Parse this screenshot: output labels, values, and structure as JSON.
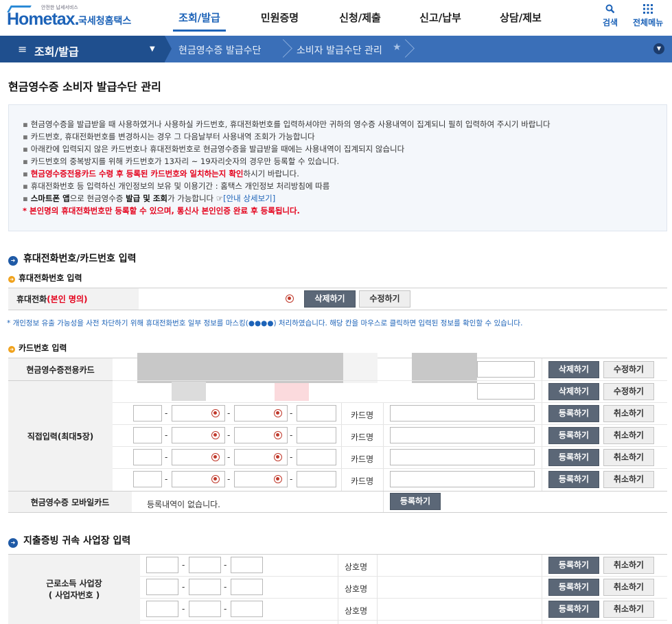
{
  "header": {
    "logo_small": "안전한 납세서비스",
    "logo_main": "Hometax.",
    "logo_kr": "국세청홈택스",
    "nav": [
      "조회/발급",
      "민원증명",
      "신청/제출",
      "신고/납부",
      "상담/제보"
    ],
    "search_label": "검색",
    "menu_label": "전체메뉴"
  },
  "locbar": {
    "current": "조회/발급",
    "crumb1": "현금영수증 발급수단",
    "crumb2": "소비자 발급수단 관리"
  },
  "page": {
    "title": "현금영수증 소비자 발급수단 관리"
  },
  "notice": [
    "현금영수증을 발급받을 때 사용하였거나 사용하실 카드번호, 휴대전화번호를 입력하셔야만 귀하의 영수증 사용내역이 집계되니 필히 입력하여 주시기 바랍니다",
    "카드번호, 휴대전화번호를 변경하시는 경우 그 다음날부터 사용내역 조회가 가능합니다",
    "아래칸에 입력되지 않은 카드번호나 휴대전화번호로 현금영수증을 발급받을 때에는 사용내역이 집계되지 않습니다",
    "카드번호의 중복방지를 위해 카드번호가 13자리 ~ 19자리숫자의 경우만 등록할 수 있습니다."
  ],
  "notice_red1": "현금영수증전용카드 수령 후 등록된 카드번호와 일치하는지 확인",
  "notice_red1_tail": "하시기 바랍니다.",
  "notice_privacy": "휴대전화번호 등 입력하신 개인정보의 보유 및 이용기간 : 홈택스 개인정보 처리방침에 따름",
  "notice_app_a": "스마트폰 앱",
  "notice_app_b": "으로 현금영수증 ",
  "notice_app_c": "발급 및 조회",
  "notice_app_d": "가 가능합니다 ",
  "notice_app_link": "[안내 상세보기]",
  "notice_red2": "* 본인명의 휴대전화번호만 등록할 수 있으며, 통신사 본인인증 완료 후 등록됩니다.",
  "section1": {
    "title": "휴대전화번호/카드번호 입력",
    "phone_sub": "휴대전화번호 입력",
    "phone_label": "휴대전화",
    "phone_label_red": "(본인 명의)",
    "delete": "삭제하기",
    "edit": "수정하기",
    "mask_note": "* 개인정보 유출 가능성을 사전 차단하기 위해 휴대전화번호 일부 정보를 마스킹(●●●●) 처리하였습니다. 해당 칸을 마우스로 클릭하면 입력된 정보를 확인할 수 있습니다.",
    "card_sub": "카드번호 입력",
    "card_dedicated": "현금영수증전용카드",
    "card_direct": "직접입력(최대5장)",
    "card_name": "카드명",
    "register": "등록하기",
    "cancel": "취소하기",
    "mobile_card": "현금영수증 모바일카드",
    "mobile_none": "등록내역이 없습니다."
  },
  "section2": {
    "title": "지출증빙 귀속 사업장 입력",
    "label_line1": "근로소득 사업장",
    "label_line2": "( 사업자번호 )",
    "shop_name": "상호명",
    "register": "등록하기",
    "cancel": "취소하기"
  }
}
